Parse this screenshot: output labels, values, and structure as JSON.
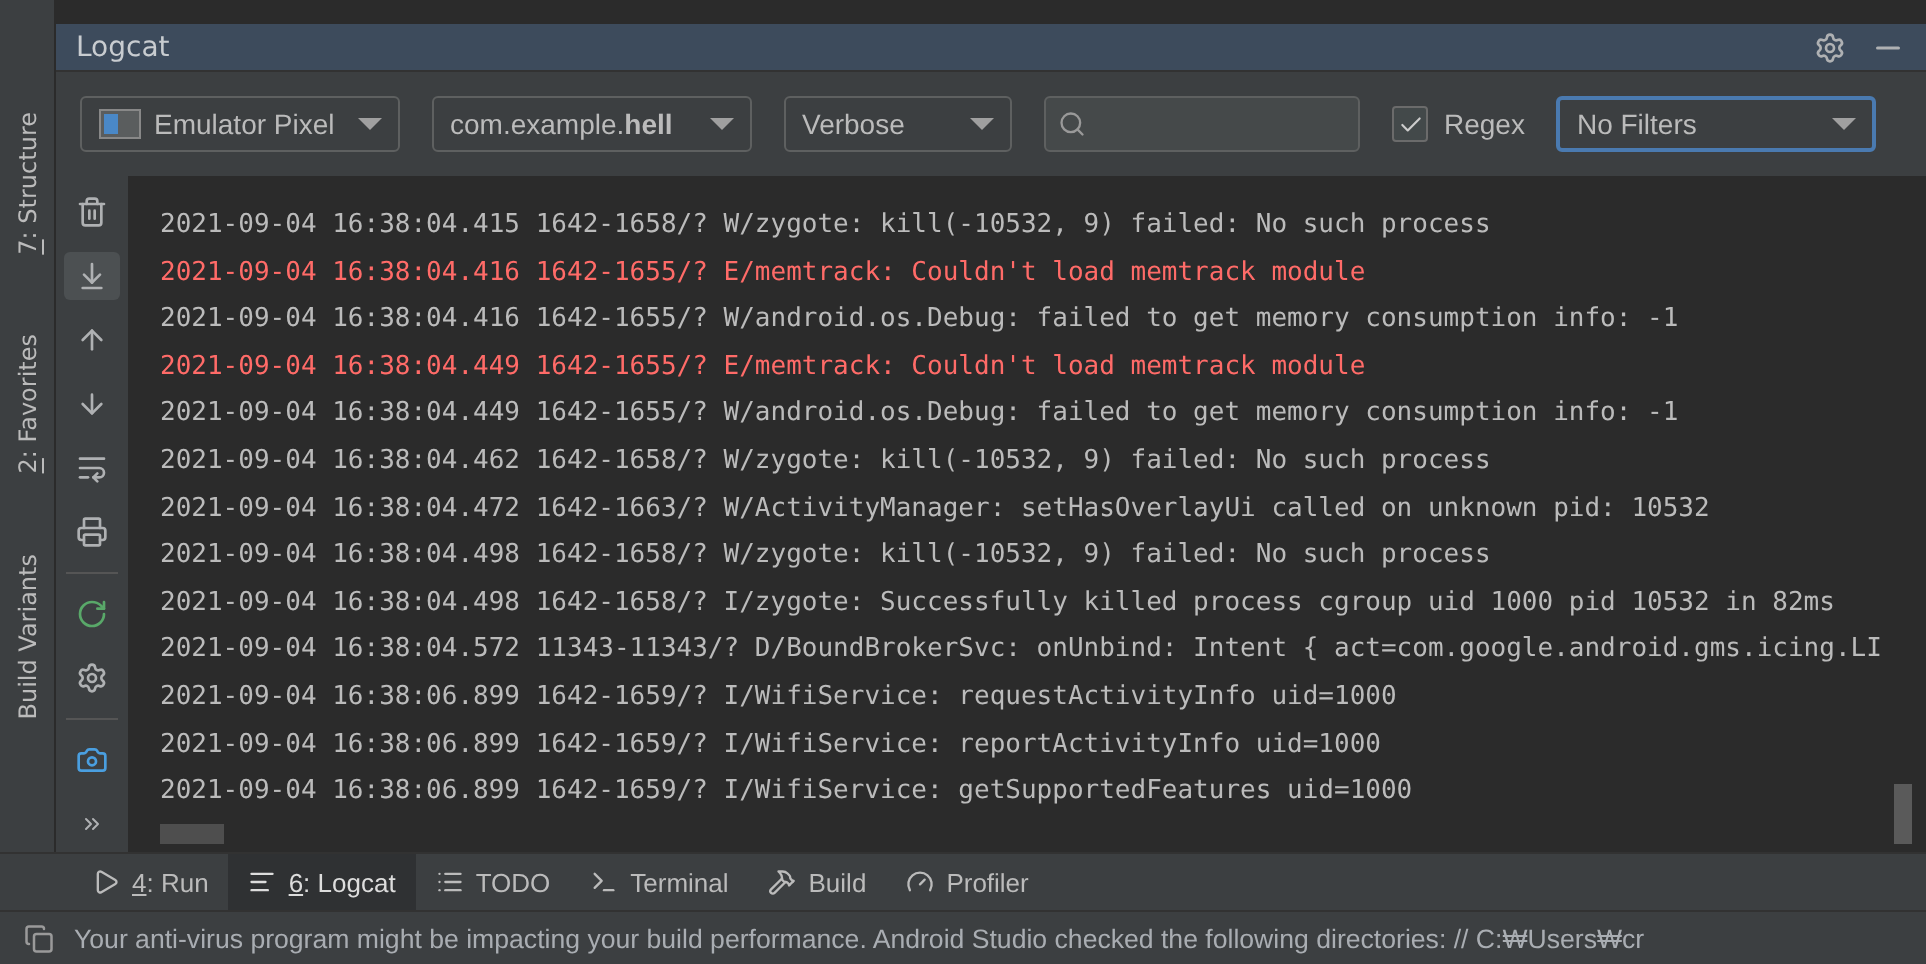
{
  "side_labels": [
    {
      "mnemonic": true,
      "text": "7: Structure"
    },
    {
      "mnemonic": true,
      "text": "2: Favorites"
    },
    {
      "mnemonic": false,
      "text": "Build Variants"
    }
  ],
  "panel": {
    "title": "Logcat"
  },
  "toolbar": {
    "device": "Emulator Pixel",
    "package": "com.example.**hell**",
    "log_level": "Verbose",
    "regex": {
      "label": "Regex",
      "checked": true
    },
    "filter": "No Filters"
  },
  "log_lines": [
    {
      "kind": "normal",
      "text": "2021-09-04 16:38:04.415 1642-1658/? W/zygote: kill(-10532, 9) failed: No such process"
    },
    {
      "kind": "error",
      "text": "2021-09-04 16:38:04.416 1642-1655/? E/memtrack: Couldn't load memtrack module"
    },
    {
      "kind": "normal",
      "text": "2021-09-04 16:38:04.416 1642-1655/? W/android.os.Debug: failed to get memory consumption info: -1"
    },
    {
      "kind": "error",
      "text": "2021-09-04 16:38:04.449 1642-1655/? E/memtrack: Couldn't load memtrack module"
    },
    {
      "kind": "normal",
      "text": "2021-09-04 16:38:04.449 1642-1655/? W/android.os.Debug: failed to get memory consumption info: -1"
    },
    {
      "kind": "normal",
      "text": "2021-09-04 16:38:04.462 1642-1658/? W/zygote: kill(-10532, 9) failed: No such process"
    },
    {
      "kind": "normal",
      "text": "2021-09-04 16:38:04.472 1642-1663/? W/ActivityManager: setHasOverlayUi called on unknown pid: 10532"
    },
    {
      "kind": "normal",
      "text": "2021-09-04 16:38:04.498 1642-1658/? W/zygote: kill(-10532, 9) failed: No such process"
    },
    {
      "kind": "normal",
      "text": "2021-09-04 16:38:04.498 1642-1658/? I/zygote: Successfully killed process cgroup uid 1000 pid 10532 in 82ms"
    },
    {
      "kind": "normal",
      "text": "2021-09-04 16:38:04.572 11343-11343/? D/BoundBrokerSvc: onUnbind: Intent { act=com.google.android.gms.icing.LI"
    },
    {
      "kind": "normal",
      "text": "2021-09-04 16:38:06.899 1642-1659/? I/WifiService: requestActivityInfo uid=1000"
    },
    {
      "kind": "normal",
      "text": "2021-09-04 16:38:06.899 1642-1659/? I/WifiService: reportActivityInfo uid=1000"
    },
    {
      "kind": "normal",
      "text": "2021-09-04 16:38:06.899 1642-1659/? I/WifiService: getSupportedFeatures uid=1000"
    }
  ],
  "bottom_tabs": [
    {
      "kind": "run",
      "mnemonic": true,
      "label": "4: Run",
      "selected": false
    },
    {
      "kind": "logcat",
      "mnemonic": true,
      "label": "6: Logcat",
      "selected": true
    },
    {
      "kind": "todo",
      "mnemonic": false,
      "label": "TODO",
      "selected": false
    },
    {
      "kind": "terminal",
      "mnemonic": false,
      "label": "Terminal",
      "selected": false
    },
    {
      "kind": "build",
      "mnemonic": false,
      "label": "Build",
      "selected": false
    },
    {
      "kind": "profiler",
      "mnemonic": false,
      "label": "Profiler",
      "selected": false
    }
  ],
  "status_bar": "Your anti-virus program might be impacting your build performance. Android Studio checked the following directories: // C:₩Users₩cr"
}
